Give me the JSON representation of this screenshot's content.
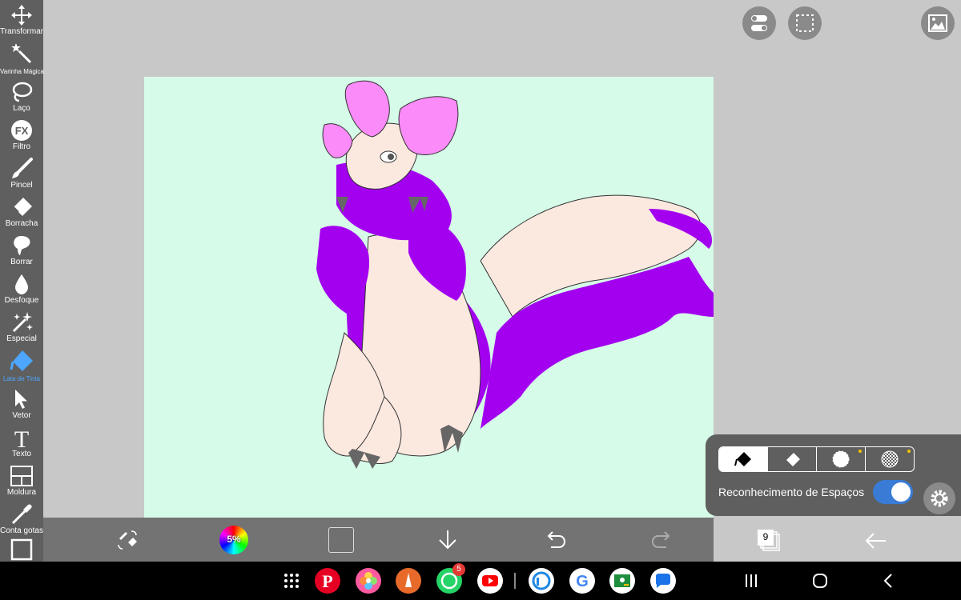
{
  "toolbar": {
    "tools": [
      {
        "label": "Transformar",
        "icon": "move-icon"
      },
      {
        "label": "Varinha Mágica",
        "icon": "magic-wand-icon"
      },
      {
        "label": "Laço",
        "icon": "lasso-icon"
      },
      {
        "label": "Filtro",
        "icon": "fx-icon"
      },
      {
        "label": "Pincel",
        "icon": "brush-icon"
      },
      {
        "label": "Borracha",
        "icon": "eraser-icon"
      },
      {
        "label": "Borrar",
        "icon": "smudge-icon"
      },
      {
        "label": "Desfoque",
        "icon": "blur-drop-icon"
      },
      {
        "label": "Especial",
        "icon": "sparkle-icon"
      },
      {
        "label": "Lata de Tinta",
        "icon": "paint-bucket-icon",
        "active": true
      },
      {
        "label": "Vetor",
        "icon": "cursor-arrow-icon"
      },
      {
        "label": "Texto",
        "icon": "text-icon"
      },
      {
        "label": "Moldura",
        "icon": "frame-icon"
      },
      {
        "label": "Conta gotas",
        "icon": "eyedropper-icon"
      }
    ]
  },
  "colors": {
    "toolbar_bg": "#5f5f5f",
    "workspace_bg": "#c8c8c8",
    "canvas_bg": "#d6fbe8",
    "active_tool": "#4da6ff",
    "fur_purple": "#a300f0",
    "body_cream": "#fbe9e0",
    "petal_pink": "#fb8bf9",
    "toggle_on": "#3a7bd5"
  },
  "bottom_bar": {
    "color_wheel_percent": "5%",
    "layer_count": "9"
  },
  "fill_panel": {
    "modes": [
      "paint-bucket-mode",
      "eraser-mode",
      "circle-mode",
      "checker-mode"
    ],
    "gap_recognition_label": "Reconhecimento de Espaços",
    "gap_recognition_on": true
  },
  "taskbar": {
    "apps": [
      "Pinterest",
      "Blossom",
      "Sketchbook",
      "WhatsApp",
      "YouTube",
      "ibisPaint",
      "Google",
      "Classroom",
      "Messages"
    ],
    "whatsapp_badge": "5"
  }
}
